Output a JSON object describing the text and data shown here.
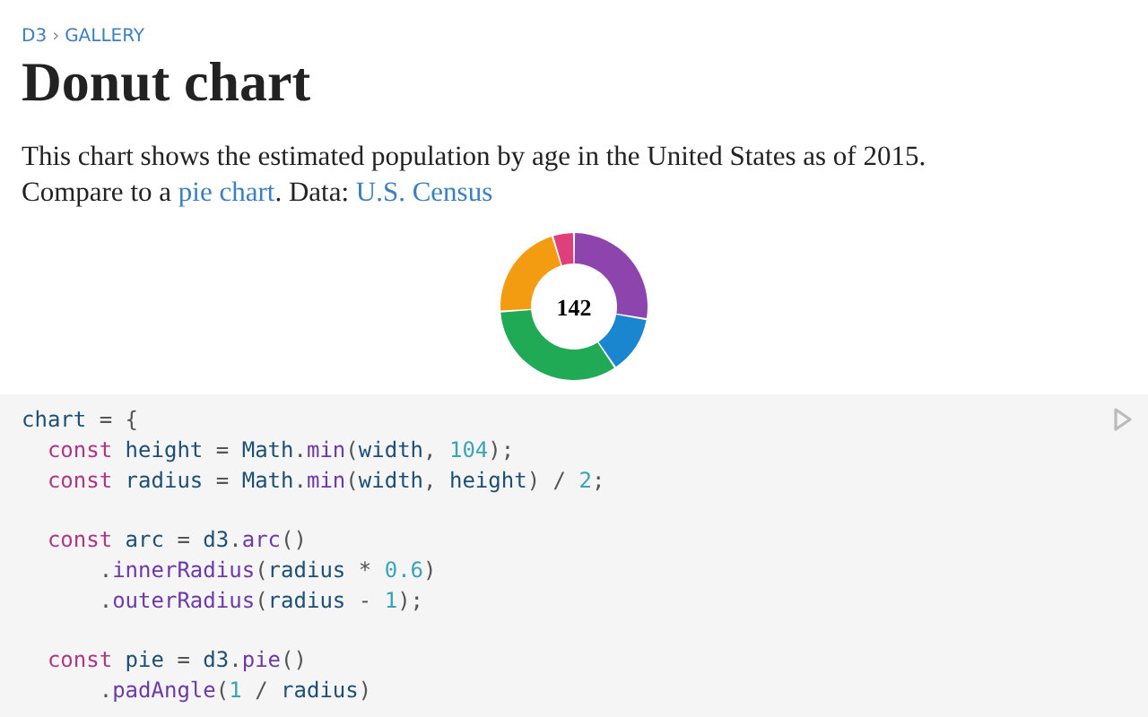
{
  "breadcrumb": [
    {
      "label": "D3"
    },
    {
      "label": "›",
      "kind": "separator"
    },
    {
      "label": "GALLERY"
    }
  ],
  "title": "Donut chart",
  "description": [
    [
      {
        "kind": "text",
        "text": "This chart shows the estimated population by age in the United States as of 2015."
      }
    ],
    [
      {
        "kind": "text",
        "text": "Compare to a "
      },
      {
        "kind": "link",
        "text": "pie chart"
      },
      {
        "kind": "text",
        "text": ". Data: "
      },
      {
        "kind": "link",
        "text": "U.S. Census"
      }
    ]
  ],
  "donut": {
    "center_label": "142"
  },
  "code": [
    {
      "kind": "code",
      "tokens": [
        {
          "kind": "var",
          "t": "chart"
        },
        {
          "kind": "op",
          "t": " = {"
        }
      ]
    },
    {
      "kind": "code",
      "tokens": [
        {
          "kind": "keyword",
          "t": "  const"
        },
        {
          "kind": "var",
          "t": " height"
        },
        {
          "kind": "op",
          "t": " = "
        },
        {
          "kind": "var",
          "t": "Math"
        },
        {
          "kind": "op",
          "t": "."
        },
        {
          "kind": "fn",
          "t": "min"
        },
        {
          "kind": "op",
          "t": "("
        },
        {
          "kind": "var",
          "t": "width"
        },
        {
          "kind": "op",
          "t": ", "
        },
        {
          "kind": "num",
          "t": "104"
        },
        {
          "kind": "op",
          "t": ");"
        }
      ]
    },
    {
      "kind": "code",
      "tokens": [
        {
          "kind": "keyword",
          "t": "  const"
        },
        {
          "kind": "var",
          "t": " radius"
        },
        {
          "kind": "op",
          "t": " = "
        },
        {
          "kind": "var",
          "t": "Math"
        },
        {
          "kind": "op",
          "t": "."
        },
        {
          "kind": "fn",
          "t": "min"
        },
        {
          "kind": "op",
          "t": "("
        },
        {
          "kind": "var",
          "t": "width"
        },
        {
          "kind": "op",
          "t": ", "
        },
        {
          "kind": "var",
          "t": "height"
        },
        {
          "kind": "op",
          "t": ") / "
        },
        {
          "kind": "num",
          "t": "2"
        },
        {
          "kind": "op",
          "t": ";"
        }
      ]
    },
    {
      "kind": "blank"
    },
    {
      "kind": "code",
      "tokens": [
        {
          "kind": "keyword",
          "t": "  const"
        },
        {
          "kind": "var",
          "t": " arc"
        },
        {
          "kind": "op",
          "t": " = "
        },
        {
          "kind": "var",
          "t": "d3"
        },
        {
          "kind": "op",
          "t": "."
        },
        {
          "kind": "fn",
          "t": "arc"
        },
        {
          "kind": "op",
          "t": "()"
        }
      ]
    },
    {
      "kind": "code",
      "tokens": [
        {
          "kind": "op",
          "t": "      ."
        },
        {
          "kind": "fn",
          "t": "innerRadius"
        },
        {
          "kind": "op",
          "t": "("
        },
        {
          "kind": "var",
          "t": "radius"
        },
        {
          "kind": "op",
          "t": " * "
        },
        {
          "kind": "num",
          "t": "0.6"
        },
        {
          "kind": "op",
          "t": ")"
        }
      ]
    },
    {
      "kind": "code",
      "tokens": [
        {
          "kind": "op",
          "t": "      ."
        },
        {
          "kind": "fn",
          "t": "outerRadius"
        },
        {
          "kind": "op",
          "t": "("
        },
        {
          "kind": "var",
          "t": "radius"
        },
        {
          "kind": "op",
          "t": " - "
        },
        {
          "kind": "num",
          "t": "1"
        },
        {
          "kind": "op",
          "t": ");"
        }
      ]
    },
    {
      "kind": "blank"
    },
    {
      "kind": "code",
      "tokens": [
        {
          "kind": "keyword",
          "t": "  const"
        },
        {
          "kind": "var",
          "t": " pie"
        },
        {
          "kind": "op",
          "t": " = "
        },
        {
          "kind": "var",
          "t": "d3"
        },
        {
          "kind": "op",
          "t": "."
        },
        {
          "kind": "fn",
          "t": "pie"
        },
        {
          "kind": "op",
          "t": "()"
        }
      ]
    },
    {
      "kind": "code",
      "tokens": [
        {
          "kind": "op",
          "t": "      ."
        },
        {
          "kind": "fn",
          "t": "padAngle"
        },
        {
          "kind": "op",
          "t": "("
        },
        {
          "kind": "num",
          "t": "1"
        },
        {
          "kind": "op",
          "t": " / "
        },
        {
          "kind": "var",
          "t": "radius"
        },
        {
          "kind": "op",
          "t": ")"
        }
      ]
    }
  ]
}
